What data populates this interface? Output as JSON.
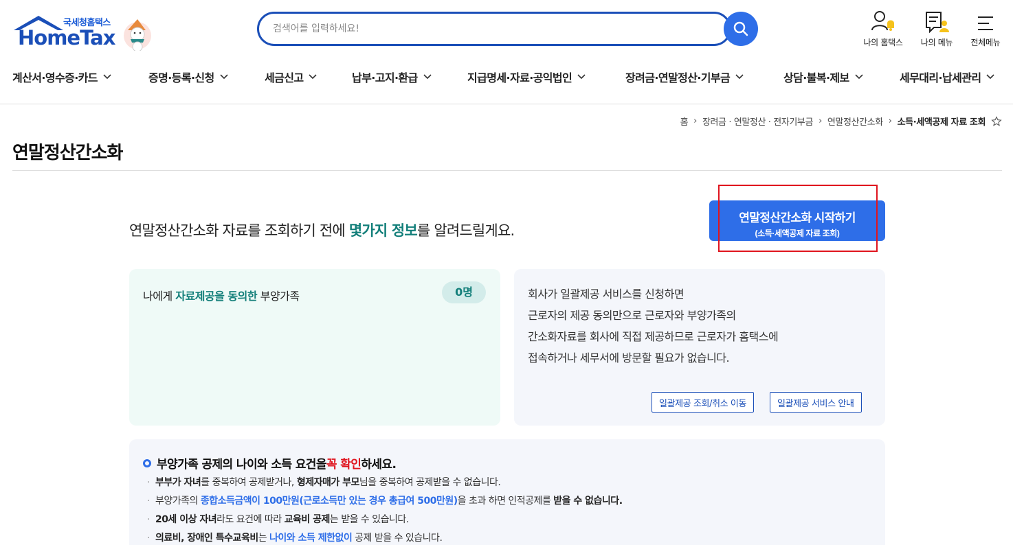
{
  "header": {
    "logo_sub": "국세청홈택스",
    "logo_main": "HomeTax",
    "search_placeholder": "검색어를 입력하세요!",
    "icons": [
      {
        "label": "나의 홈택스",
        "icon": "user-bell-icon"
      },
      {
        "label": "나의 메뉴",
        "icon": "doc-user-icon"
      },
      {
        "label": "전체메뉴",
        "icon": "hamburger-icon"
      }
    ]
  },
  "gnb": [
    "계산서·영수증·카드",
    "증명·등록·신청",
    "세금신고",
    "납부·고지·환급",
    "지급명세·자료·공익법인",
    "장려금·연말정산·기부금",
    "상담·불복·제보",
    "세무대리·납세관리"
  ],
  "breadcrumb": [
    "홈",
    "장려금 · 연말정산 · 전자기부금",
    "연말정산간소화",
    "소득·세액공제 자료 조회"
  ],
  "page_title": "연말정산간소화",
  "intro": {
    "pre": "연말정산간소화 자료를 조회하기 전에 ",
    "highlight": "몇가지 정보",
    "post": "를 알려드릴게요."
  },
  "start_button": {
    "line1": "연말정산간소화 시작하기",
    "line2": "(소득·세액공제 자료 조회)"
  },
  "consent_card": {
    "pre": "나에게 ",
    "highlight": "자료제공을 동의한",
    "post": " 부양가족",
    "count": "0명"
  },
  "bulk_card": {
    "lines": [
      "회사가 일괄제공 서비스를 신청하면",
      "근로자의 제공 동의만으로 근로자와 부양가족의",
      "간소화자료를 회사에 직접 제공하므로 근로자가 홈택스에",
      "접속하거나 세무서에 방문할 필요가 없습니다."
    ],
    "btn_query": "일괄제공 조회/취소 이동",
    "btn_guide": "일괄제공 서비스 안내"
  },
  "notice": {
    "title_pre": "부양가족 공제의 나이와 소득 요건을 ",
    "title_red": "꼭 확인",
    "title_post": "하세요.",
    "items": [
      [
        {
          "t": "부부가 자녀",
          "s": "b"
        },
        {
          "t": "를 중복하여 공제받거나, "
        },
        {
          "t": "형제자매가 부모",
          "s": "b"
        },
        {
          "t": "님을 중복하여 공제받을 수 없습니다."
        }
      ],
      [
        {
          "t": "부양가족의 "
        },
        {
          "t": "종합소득금액이 100만원(근로소득만 있는 경우 총급여 500만원)",
          "s": "blue"
        },
        {
          "t": "을 초과 하면 인적공제를 "
        },
        {
          "t": "받을 수 없습니다.",
          "s": "b"
        }
      ],
      [
        {
          "t": "20세 이상 자녀",
          "s": "b"
        },
        {
          "t": "라도 요건에 따라 "
        },
        {
          "t": "교육비 공제",
          "s": "b"
        },
        {
          "t": "는 받을 수 있습니다."
        }
      ],
      [
        {
          "t": "의료비, 장애인 특수교육비",
          "s": "b"
        },
        {
          "t": "는 "
        },
        {
          "t": "나이와 소득 제한없이",
          "s": "blue"
        },
        {
          "t": " 공제 받을 수 있습니다."
        }
      ]
    ]
  }
}
